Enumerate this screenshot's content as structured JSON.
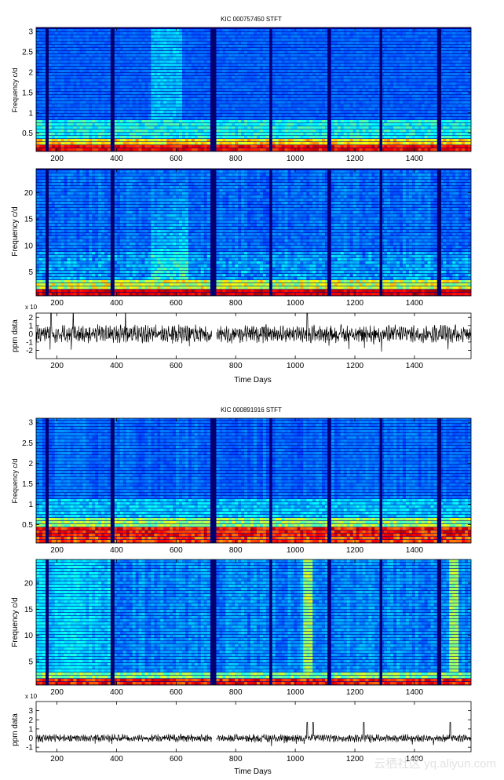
{
  "chart_data": [
    {
      "type": "heatmap",
      "title": "KIC 000757450 STFT",
      "ylabel": "Frequency c/d",
      "xlabel": "",
      "xlim": [
        130,
        1590
      ],
      "ylim": [
        0.05,
        3.1
      ],
      "yticks": [
        0.5,
        1,
        1.5,
        2,
        2.5,
        3
      ],
      "ytick_labels": [
        "0.5",
        "1",
        "1.5",
        "2",
        "2.5",
        "3"
      ],
      "xticks": [
        200,
        400,
        600,
        800,
        1000,
        1200,
        1400
      ],
      "xtick_labels": [
        "200",
        "400",
        "600",
        "800",
        "1000",
        "1200",
        "1400"
      ],
      "colormap": "jet",
      "data_gaps": [
        [
          162,
          172
        ],
        [
          380,
          393
        ],
        [
          717,
          733
        ],
        [
          916,
          920
        ],
        [
          1108,
          1116
        ],
        [
          1283,
          1292
        ],
        [
          1478,
          1490
        ]
      ],
      "description_of_values": "power concentrated near lowest frequencies (red band near 0.1 c/d), broadband enhancement between 500 and 620 days"
    },
    {
      "type": "heatmap",
      "title": "",
      "ylabel": "Frequency c/d",
      "xlabel": "",
      "xlim": [
        130,
        1590
      ],
      "ylim": [
        0.5,
        24.5
      ],
      "yticks": [
        5,
        10,
        15,
        20
      ],
      "ytick_labels": [
        "5",
        "10",
        "15",
        "20"
      ],
      "xticks": [
        200,
        400,
        600,
        800,
        1000,
        1200,
        1400
      ],
      "xtick_labels": [
        "200",
        "400",
        "600",
        "800",
        "1000",
        "1200",
        "1400"
      ],
      "colormap": "jet",
      "data_gaps": [
        [
          162,
          172
        ],
        [
          380,
          393
        ],
        [
          717,
          733
        ],
        [
          916,
          920
        ],
        [
          1108,
          1116
        ],
        [
          1283,
          1292
        ],
        [
          1478,
          1490
        ]
      ]
    },
    {
      "type": "line",
      "title": "",
      "ylabel": "ppm data",
      "xlabel": "Time Days",
      "exponent_label": "x 10",
      "xlim": [
        130,
        1590
      ],
      "ylim": [
        -3,
        2.5
      ],
      "yticks": [
        -2,
        -1,
        0,
        1,
        2
      ],
      "ytick_labels": [
        "-2",
        "-1",
        "0",
        "1",
        "2"
      ],
      "xticks": [
        200,
        400,
        600,
        800,
        1000,
        1200,
        1400
      ],
      "xtick_labels": [
        "200",
        "400",
        "600",
        "800",
        "1000",
        "1200",
        "1400"
      ],
      "series": [
        {
          "amplitude": 0.9,
          "spike_days": [
            180,
            255,
            430,
            1040
          ],
          "gap": [
            720,
            735
          ]
        }
      ]
    },
    {
      "type": "heatmap",
      "title": "KIC 000891916 STFT",
      "ylabel": "Frequency c/d",
      "xlabel": "",
      "xlim": [
        130,
        1590
      ],
      "ylim": [
        0.05,
        3.1
      ],
      "yticks": [
        0.5,
        1,
        1.5,
        2,
        2.5,
        3
      ],
      "ytick_labels": [
        "0.5",
        "1",
        "1.5",
        "2",
        "2.5",
        "3"
      ],
      "xticks": [
        200,
        400,
        600,
        800,
        1000,
        1200,
        1400
      ],
      "xtick_labels": [
        "200",
        "400",
        "600",
        "800",
        "1000",
        "1200",
        "1400"
      ],
      "colormap": "jet",
      "data_gaps": [
        [
          162,
          172
        ],
        [
          380,
          393
        ],
        [
          717,
          733
        ],
        [
          916,
          920
        ],
        [
          1108,
          1116
        ],
        [
          1283,
          1292
        ],
        [
          1478,
          1490
        ]
      ],
      "description_of_values": "strong power band between 0.1 and 0.5 c/d (red/yellow), weak power above 1 c/d"
    },
    {
      "type": "heatmap",
      "title": "",
      "ylabel": "Frequency c/d",
      "xlabel": "",
      "xlim": [
        130,
        1590
      ],
      "ylim": [
        0.5,
        24.5
      ],
      "yticks": [
        5,
        10,
        15,
        20
      ],
      "ytick_labels": [
        "5",
        "10",
        "15",
        "20"
      ],
      "xticks": [
        200,
        400,
        600,
        800,
        1000,
        1200,
        1400
      ],
      "xtick_labels": [
        "200",
        "400",
        "600",
        "800",
        "1000",
        "1200",
        "1400"
      ],
      "colormap": "jet",
      "data_gaps": [
        [
          162,
          172
        ],
        [
          380,
          393
        ],
        [
          717,
          733
        ],
        [
          916,
          920
        ],
        [
          1108,
          1116
        ],
        [
          1283,
          1292
        ],
        [
          1478,
          1490
        ]
      ],
      "bright_vertical_bands": [
        1040,
        1530
      ]
    },
    {
      "type": "line",
      "title": "",
      "ylabel": "ppm data",
      "xlabel": "Time Days",
      "exponent_label": "x 10",
      "xlim": [
        130,
        1590
      ],
      "ylim": [
        -1.5,
        4
      ],
      "yticks": [
        -1,
        0,
        1,
        2,
        3
      ],
      "ytick_labels": [
        "-1",
        "0",
        "1",
        "2",
        "3"
      ],
      "xticks": [
        200,
        400,
        600,
        800,
        1000,
        1200,
        1400
      ],
      "xtick_labels": [
        "200",
        "400",
        "600",
        "800",
        "1000",
        "1200",
        "1400"
      ],
      "series": [
        {
          "amplitude": 0.35,
          "spike_days": [
            1040,
            1060,
            1230,
            1520
          ],
          "gap": [
            720,
            735
          ]
        }
      ]
    }
  ],
  "watermark": "云栖社区 yq.aliyun.com"
}
